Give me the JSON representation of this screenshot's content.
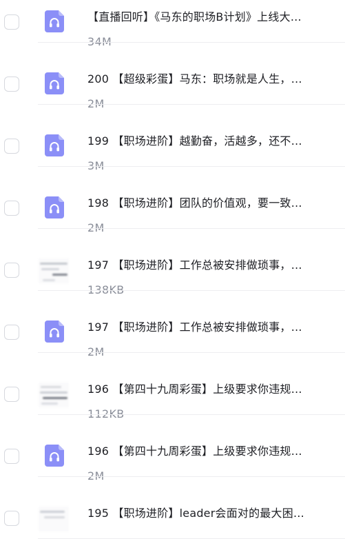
{
  "files": [
    {
      "title": "【直播回听】《马东的职场B计划》上线大…",
      "size": "34M",
      "thumb": "audio"
    },
    {
      "title": "200 【超级彩蛋】马东：职场就是人生，…",
      "size": "2M",
      "thumb": "audio"
    },
    {
      "title": "199 【职场进阶】越勤奋，活越多，还不…",
      "size": "3M",
      "thumb": "audio"
    },
    {
      "title": "198 【职场进阶】团队的价值观，要一致…",
      "size": "2M",
      "thumb": "audio"
    },
    {
      "title": "197 【职场进阶】工作总被安排做琐事，…",
      "size": "138KB",
      "thumb": "image"
    },
    {
      "title": "197 【职场进阶】工作总被安排做琐事，…",
      "size": "2M",
      "thumb": "audio"
    },
    {
      "title": "196 【第四十九周彩蛋】上级要求你违规…",
      "size": "112KB",
      "thumb": "image"
    },
    {
      "title": "196 【第四十九周彩蛋】上级要求你违规…",
      "size": "2M",
      "thumb": "audio"
    },
    {
      "title": "195 【职场进阶】leader会面对的最大困…",
      "size": "",
      "thumb": "image"
    }
  ],
  "colors": {
    "audio_icon": "#8b8ff7",
    "audio_icon_fold": "#b9bcfa"
  },
  "icons": {
    "audio": "headphones-file-icon",
    "image": "image-thumbnail"
  }
}
